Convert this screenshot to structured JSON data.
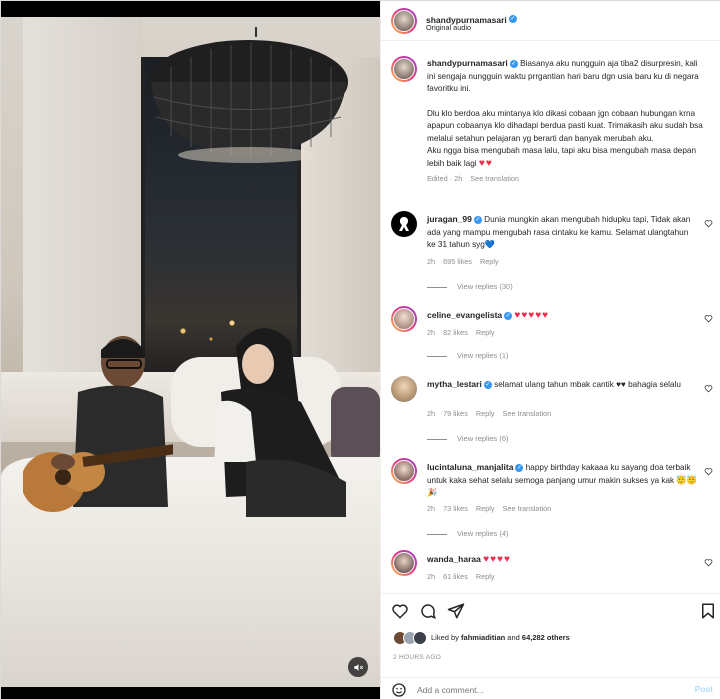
{
  "header": {
    "username": "shandypurnamasari",
    "subtitle": "Original audio"
  },
  "caption": {
    "username": "shandypurnamasari",
    "paragraph1": "Biasanya aku nungguin aja tiba2 disurpresin, kali ini sengaja nungguin waktu prrgantian hari baru dgn usia baru ku di negara favoritku ini.",
    "paragraph2": "Dlu klo berdoa aku mintanya klo dikasi cobaan jgn cobaan hubungan krna apapun cobaanya klo dihadapi berdua pasti kuat. Trimakasih aku sudah bsa melalui setahun pelajaran yg berarti dan banyak merubah aku.",
    "paragraph3": "Aku ngga bisa mengubah masa lalu, tapi aku bisa mengubah masa depan lebih baik lagi",
    "emoji": "♥♥",
    "edited": "Edited · 2h",
    "see_translation": "See translation"
  },
  "comments": [
    {
      "username": "juragan_99",
      "text": "Dunia mungkin akan mengubah hidupku tapi, Tidak akan ada yang mampu mengubah rasa cintaku ke kamu. Selamat ulangtahun ke 31 tahun syg💙",
      "time": "2h",
      "likes": "695 likes",
      "reply": "Reply",
      "view_replies": "View replies (30)"
    },
    {
      "username": "celine_evangelista",
      "text": "♥♥♥♥♥",
      "time": "2h",
      "likes": "82 likes",
      "reply": "Reply",
      "view_replies": "View replies (1)"
    },
    {
      "username": "mytha_lestari",
      "text": "selamat ulang tahun mbak cantik ♥♥ bahagia selalu",
      "time": "2h",
      "likes": "79 likes",
      "reply": "Reply",
      "see_translation": "See translation",
      "view_replies": "View replies (6)"
    },
    {
      "username": "lucintaluna_manjalita",
      "text": "happy birthday kakaaa ku sayang doa terbaik untuk kaka sehat selalu semoga panjang umur makin sukses ya kak 😇😇🎉",
      "time": "2h",
      "likes": "73 likes",
      "reply": "Reply",
      "see_translation": "See translation",
      "view_replies": "View replies (4)"
    },
    {
      "username": "wanda_haraa",
      "text": "♥♥♥♥",
      "time": "2h",
      "likes": "61 likes",
      "reply": "Reply"
    }
  ],
  "likes": {
    "liked_by_prefix": "Liked by ",
    "liked_by_user": "fahmiaditian",
    "liked_by_suffix": " and ",
    "others": "64,282 others"
  },
  "timestamp": "2 HOURS AGO",
  "comment_input": {
    "placeholder": "Add a comment...",
    "post": "Post"
  },
  "colors": {
    "verified": "#3897f0",
    "heart": "#ed2e4b",
    "muted": "#8e8e8e",
    "post_disabled": "#b3dbff"
  }
}
